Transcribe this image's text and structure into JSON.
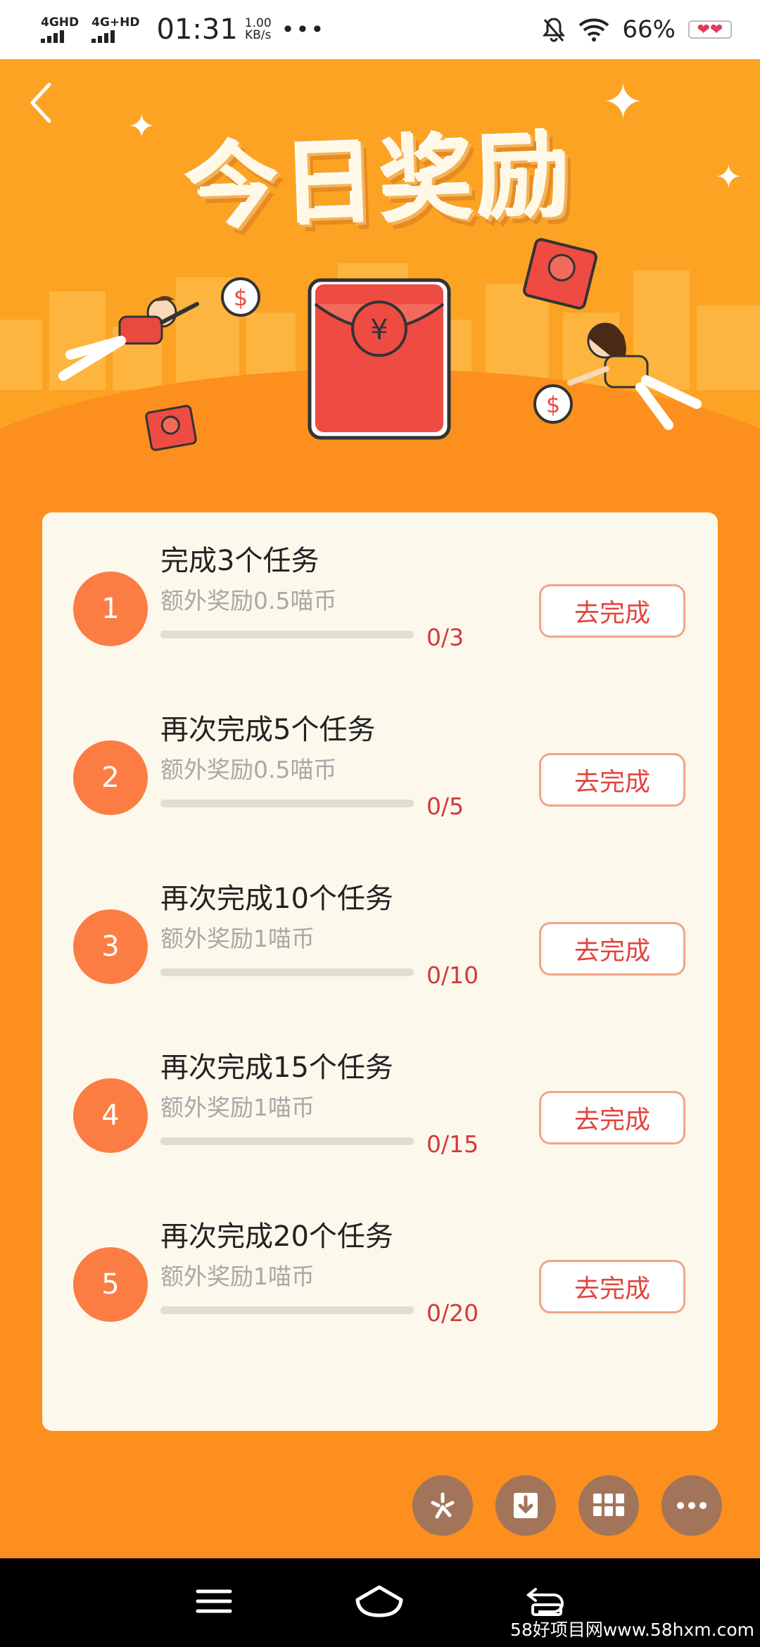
{
  "status_bar": {
    "signal1": "4GHD",
    "signal2": "4G+HD",
    "time": "01:31",
    "speed_value": "1.00",
    "speed_unit": "KB/s",
    "more": "•••",
    "battery_percent": "66%",
    "icons": [
      "mute-bell-icon",
      "wifi-icon",
      "battery-icon"
    ]
  },
  "header": {
    "back_icon": "chevron-left-icon",
    "title": "今日奖励"
  },
  "tasks": [
    {
      "number": "1",
      "title": "完成3个任务",
      "reward": "额外奖励0.5喵币",
      "progress": "0/3",
      "progress_value": 0,
      "button": "去完成"
    },
    {
      "number": "2",
      "title": "再次完成5个任务",
      "reward": "额外奖励0.5喵币",
      "progress": "0/5",
      "progress_value": 0,
      "button": "去完成"
    },
    {
      "number": "3",
      "title": "再次完成10个任务",
      "reward": "额外奖励1喵币",
      "progress": "0/10",
      "progress_value": 0,
      "button": "去完成"
    },
    {
      "number": "4",
      "title": "再次完成15个任务",
      "reward": "额外奖励1喵币",
      "progress": "0/15",
      "progress_value": 0,
      "button": "去完成"
    },
    {
      "number": "5",
      "title": "再次完成20个任务",
      "reward": "额外奖励1喵币",
      "progress": "0/20",
      "progress_value": 0,
      "button": "去完成"
    }
  ],
  "floating_buttons": [
    "sparkle-icon",
    "download-icon",
    "grid-icon",
    "more-icon"
  ],
  "nav_bar": [
    "menu-icon",
    "home-icon",
    "back-icon"
  ],
  "watermark": "58好项目网www.58hxm.com",
  "colors": {
    "background": "#fc8f1d",
    "hero": "#fca324",
    "card": "#fdf8ec",
    "badge": "#fb7d43",
    "button_text": "#e0453f",
    "progress_text": "#d03a3e"
  }
}
